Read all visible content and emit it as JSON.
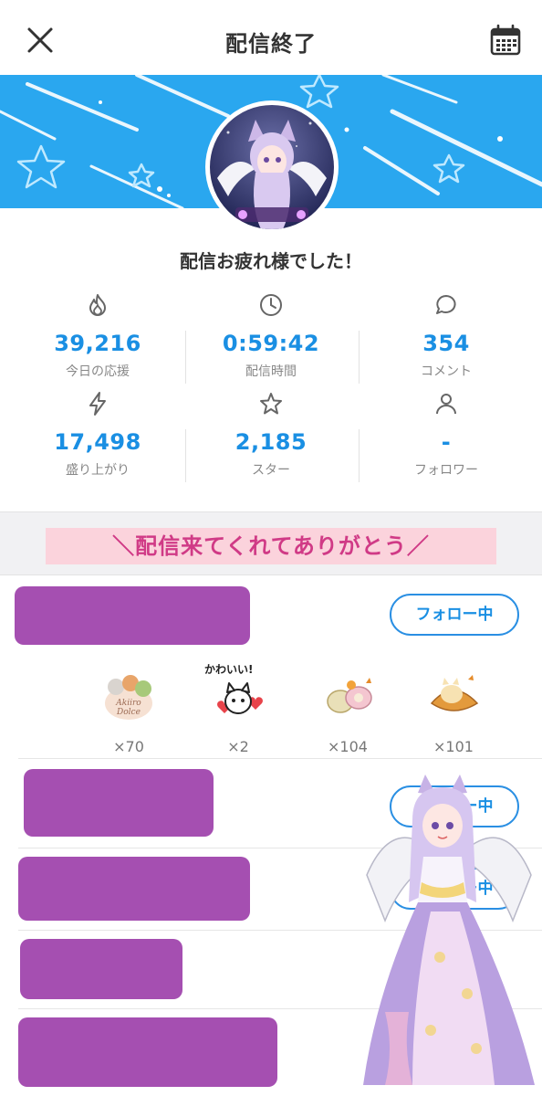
{
  "header": {
    "title": "配信終了",
    "close_icon": "close-icon",
    "calendar_icon": "calendar-icon"
  },
  "profile": {
    "thanks_message": "配信お疲れ様でした！"
  },
  "stats": [
    {
      "icon": "flame-icon",
      "value": "39,216",
      "label": "今日の応援"
    },
    {
      "icon": "clock-icon",
      "value": "0:59:42",
      "label": "配信時間"
    },
    {
      "icon": "comment-icon",
      "value": "354",
      "label": "コメント"
    },
    {
      "icon": "lightning-icon",
      "value": "17,498",
      "label": "盛り上がり"
    },
    {
      "icon": "star-icon",
      "value": "2,185",
      "label": "スター"
    },
    {
      "icon": "user-icon",
      "value": "-",
      "label": "フォロワー"
    }
  ],
  "banner_message": "＼配信来てくれてありがとう／",
  "supporters": [
    {
      "follow_label": "フォロー中",
      "gifts": [
        {
          "count": "×70"
        },
        {
          "count": "×2",
          "caption": "かわいい!"
        },
        {
          "count": "×104"
        },
        {
          "count": "×101"
        }
      ]
    },
    {
      "follow_label": "フォロー中"
    },
    {
      "follow_label": "フォロー中"
    }
  ],
  "colors": {
    "accent": "#1a8fe3",
    "banner": "#2aa7ef",
    "ribbon_bg": "#fbd3dc",
    "ribbon_text": "#d03a86",
    "redaction": "#a54fb1"
  }
}
